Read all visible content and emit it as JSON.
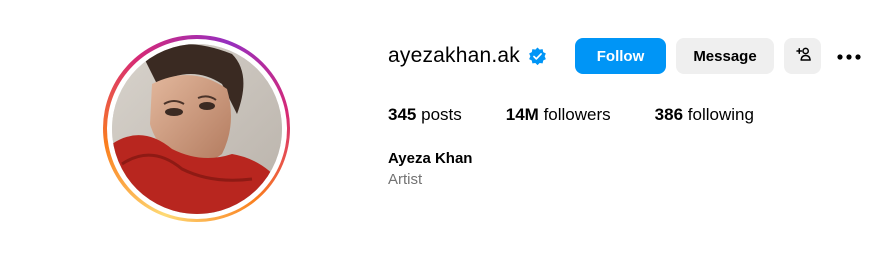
{
  "profile": {
    "username": "ayezakhan.ak",
    "verified": true,
    "full_name": "Ayeza Khan",
    "category": "Artist",
    "avatar": "profile-photo"
  },
  "actions": {
    "follow_label": "Follow",
    "message_label": "Message",
    "add_user_icon": "person-add-icon",
    "more_icon": "more-options-icon"
  },
  "stats": {
    "posts_count": "345",
    "posts_label": "posts",
    "followers_count": "14M",
    "followers_label": "followers",
    "following_count": "386",
    "following_label": "following"
  },
  "colors": {
    "primary": "#0095f6",
    "secondary_button": "#efefef",
    "muted_text": "#737373",
    "verified_badge": "#0095f6"
  }
}
